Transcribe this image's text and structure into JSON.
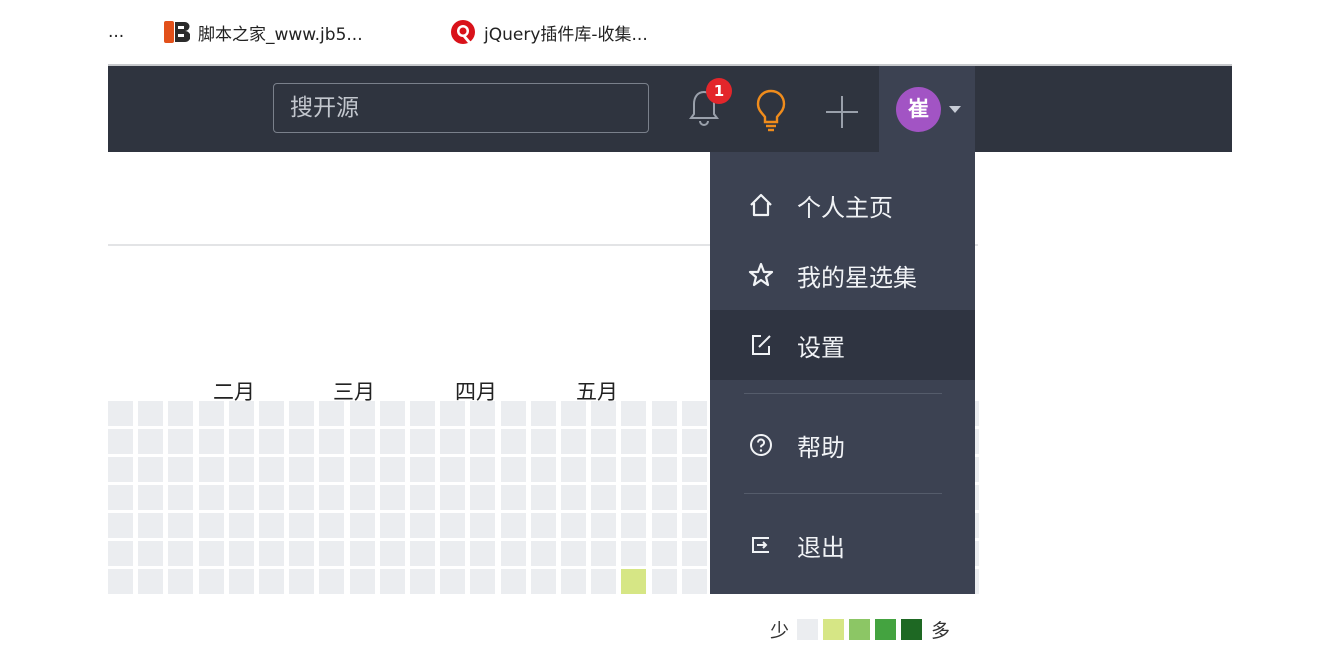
{
  "bookmarks": {
    "ellipsis": "...",
    "items": [
      {
        "label": "脚本之家_www.jb5..."
      },
      {
        "label": "jQuery插件库-收集..."
      }
    ]
  },
  "nav": {
    "search_placeholder": "搜开源",
    "notification_count": "1",
    "avatar_text": "崔"
  },
  "dropdown": {
    "items": [
      {
        "label": "个人主页"
      },
      {
        "label": "我的星选集"
      },
      {
        "label": "设置"
      },
      {
        "label": "帮助"
      },
      {
        "label": "退出"
      }
    ]
  },
  "calendar": {
    "months": [
      "二月",
      "三月",
      "四月",
      "五月"
    ],
    "legend_less": "少",
    "legend_more": "多"
  },
  "colors": {
    "nav_bg": "#2f343f",
    "dropdown_bg": "#3c4252",
    "badge": "#e3262b",
    "avatar": "#a254c4",
    "bulb": "#f08c1c",
    "level": [
      "#ebedf0",
      "#d6e685",
      "#8cc665",
      "#44a340",
      "#1e6823"
    ]
  }
}
